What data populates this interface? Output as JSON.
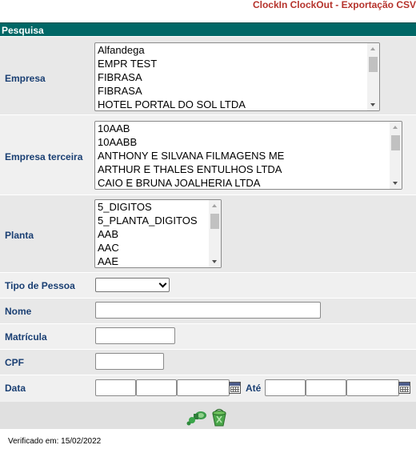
{
  "app_title": "ClockIn ClockOut - Exportação CSV",
  "section_title": "Pesquisa",
  "empresa": {
    "label": "Empresa",
    "options": [
      "Alfandega",
      "EMPR TEST",
      "FIBRASA",
      "FIBRASA",
      "HOTEL PORTAL DO SOL LTDA"
    ]
  },
  "empresa_terceira": {
    "label": "Empresa terceira",
    "options": [
      "10AAB",
      "10AABB",
      "ANTHONY E SILVANA FILMAGENS ME",
      "ARTHUR E THALES ENTULHOS LTDA",
      "CAIO E BRUNA JOALHERIA LTDA"
    ]
  },
  "planta": {
    "label": "Planta",
    "options": [
      "5_DIGITOS",
      "5_PLANTA_DIGITOS",
      "AAB",
      "AAC",
      "AAE"
    ]
  },
  "tipo_pessoa": {
    "label": "Tipo de Pessoa",
    "value": ""
  },
  "nome": {
    "label": "Nome",
    "value": ""
  },
  "matricula": {
    "label": "Matrícula",
    "value": ""
  },
  "cpf": {
    "label": "CPF",
    "value": ""
  },
  "data": {
    "label": "Data",
    "ate_label": "Até"
  },
  "footer": {
    "verified": "Verificado em: 15/02/2022"
  },
  "icons": {
    "search": "search-binoculars-icon",
    "clear": "clear-bucket-icon",
    "calendar": "calendar-icon"
  },
  "colors": {
    "header_bg": "#006766",
    "title": "#b5322b",
    "label": "#1a3f73"
  }
}
